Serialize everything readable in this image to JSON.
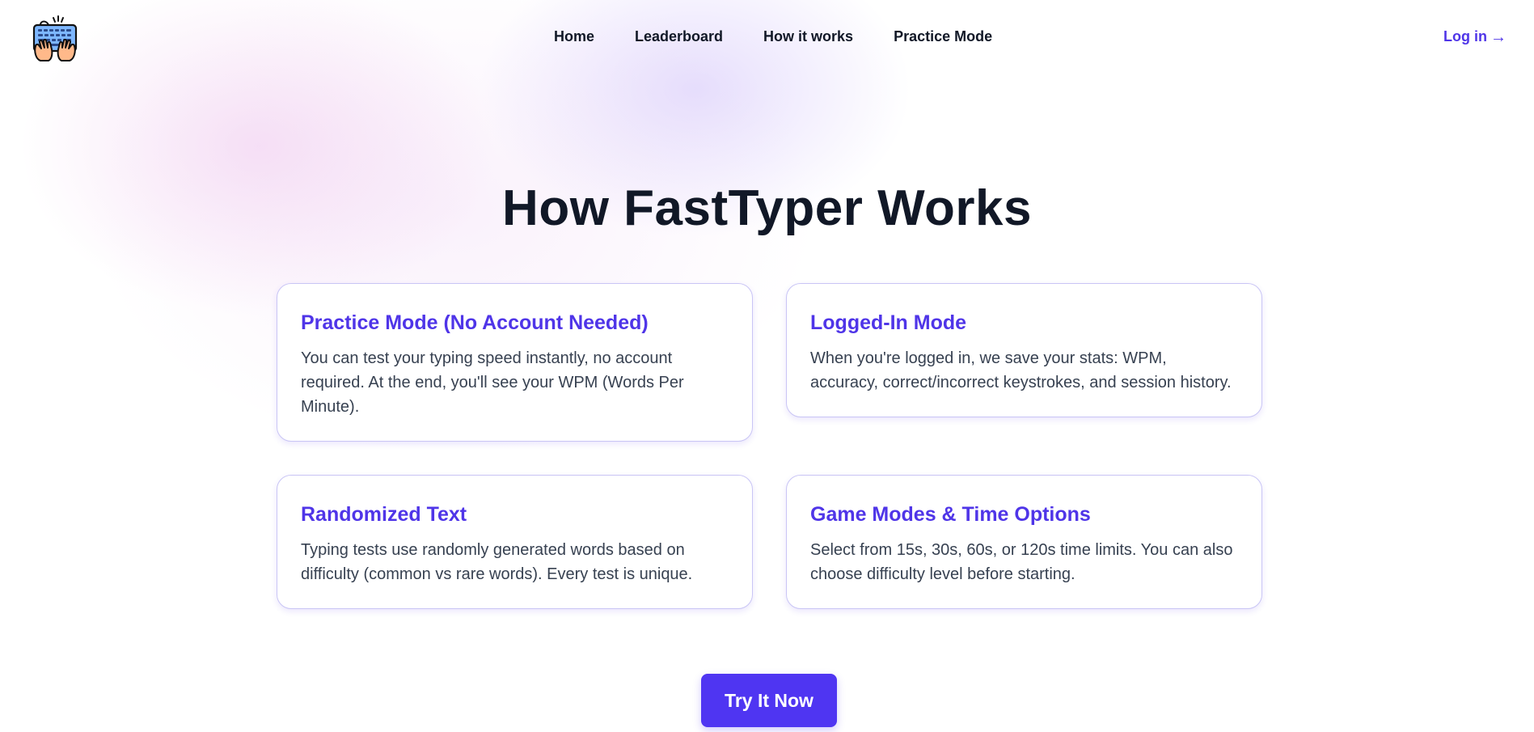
{
  "nav": {
    "links": [
      "Home",
      "Leaderboard",
      "How it works",
      "Practice Mode"
    ],
    "login_label": "Log in",
    "login_arrow": "→"
  },
  "hero": {
    "title": "How FastTyper Works"
  },
  "cards": [
    {
      "title": "Practice Mode (No Account Needed)",
      "body": "You can test your typing speed instantly, no account required. At the end, you'll see your WPM (Words Per Minute)."
    },
    {
      "title": "Logged-In Mode",
      "body": "When you're logged in, we save your stats: WPM, accuracy, correct/incorrect keystrokes, and session history."
    },
    {
      "title": "Randomized Text",
      "body": "Typing tests use randomly generated words based on difficulty (common vs rare words). Every test is unique."
    },
    {
      "title": "Game Modes & Time Options",
      "body": "Select from 15s, 30s, 60s, or 120s time limits. You can also choose difficulty level before starting."
    }
  ],
  "cta": {
    "label": "Try It Now"
  },
  "colors": {
    "accent": "#4f35e8",
    "button": "#4f35f2",
    "card_border": "#c9c5f5",
    "heading": "#111827",
    "body_text": "#374151"
  },
  "icons": {
    "logo": "typing-hands-keyboard-icon"
  }
}
